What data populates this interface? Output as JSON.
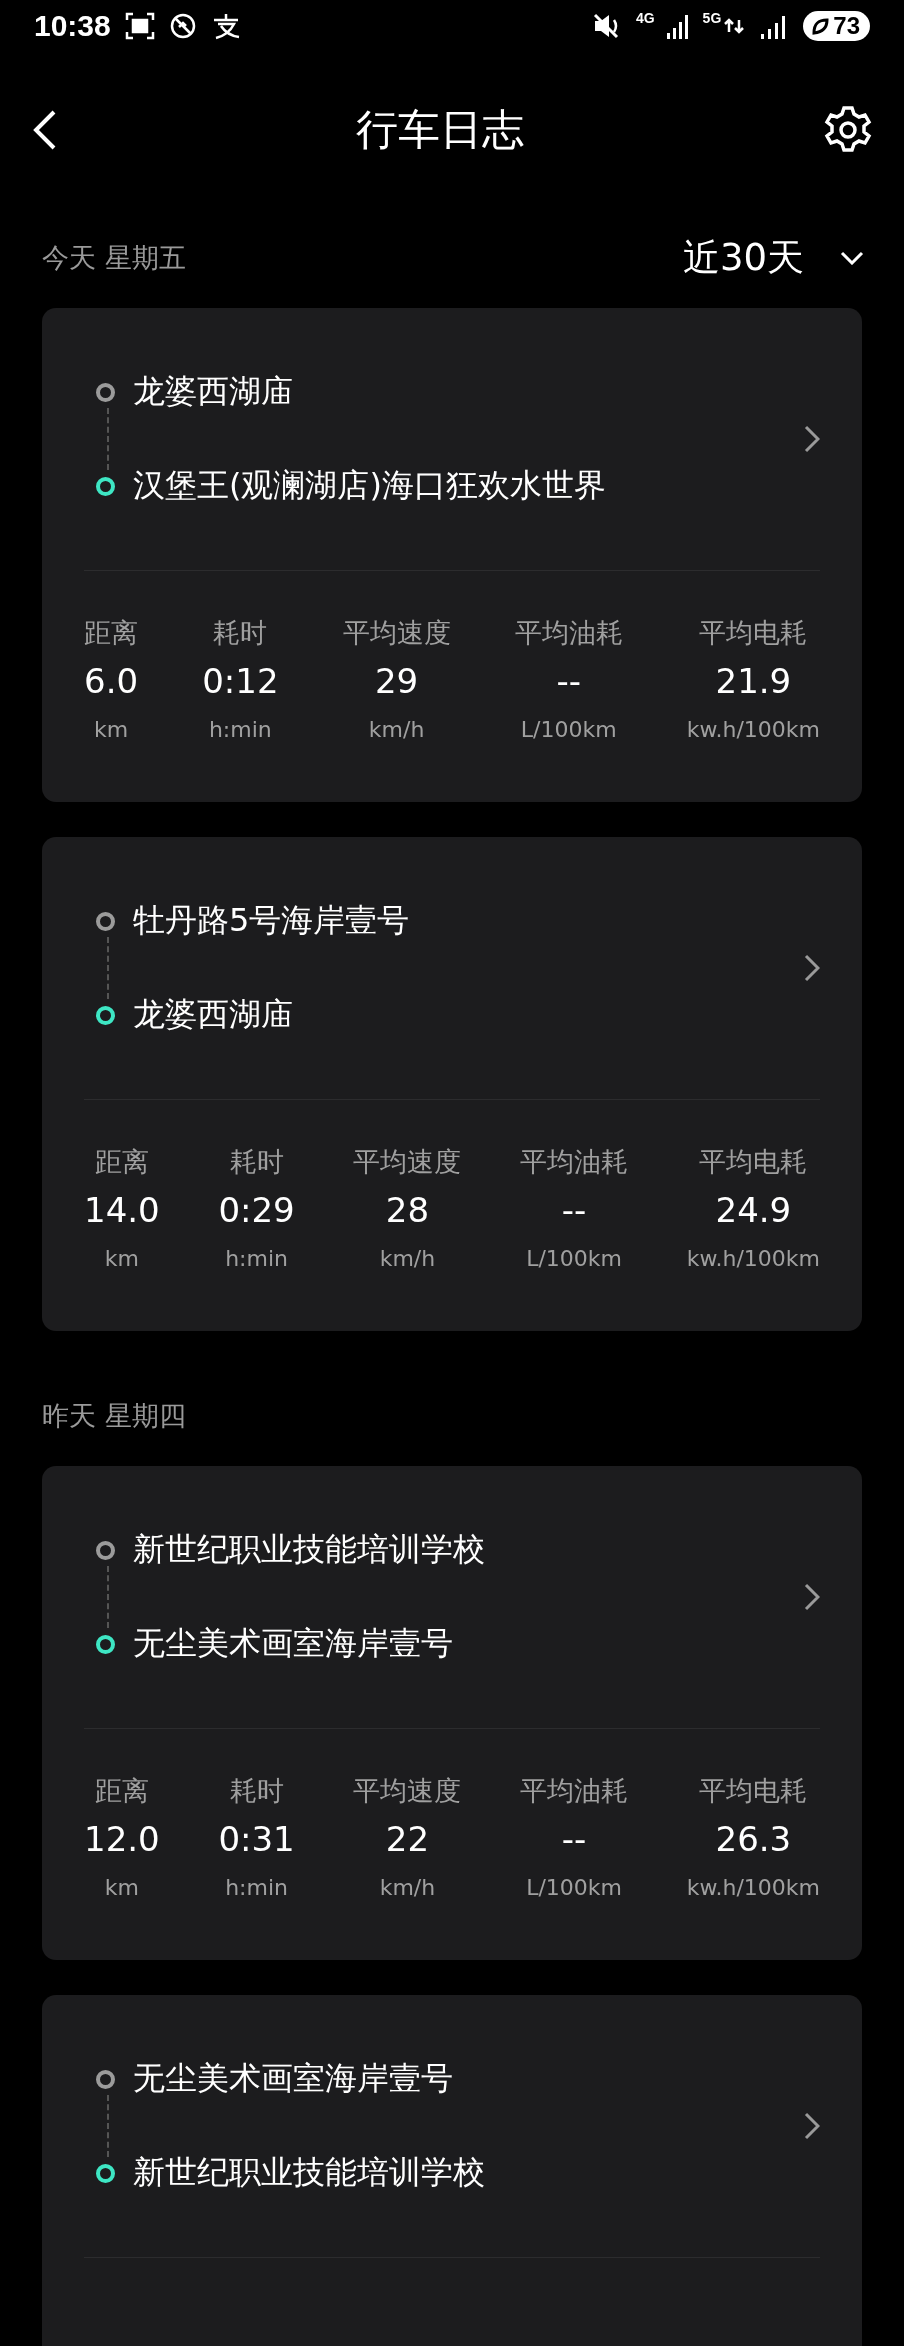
{
  "status_bar": {
    "time": "10:38",
    "network_1": "4G",
    "network_2": "5G",
    "battery": "73"
  },
  "header": {
    "title": "行车日志"
  },
  "filter": {
    "label": "近30天"
  },
  "sections": [
    {
      "label": "今天 星期五",
      "trips": [
        {
          "from": "龙婆西湖庙",
          "to": "汉堡王(观澜湖店)海口狂欢水世界",
          "stats": [
            {
              "label": "距离",
              "value": "6.0",
              "unit": "km"
            },
            {
              "label": "耗时",
              "value": "0:12",
              "unit": "h:min"
            },
            {
              "label": "平均速度",
              "value": "29",
              "unit": "km/h"
            },
            {
              "label": "平均油耗",
              "value": "--",
              "unit": "L/100km"
            },
            {
              "label": "平均电耗",
              "value": "21.9",
              "unit": "kw.h/100km"
            }
          ]
        },
        {
          "from": "牡丹路5号海岸壹号",
          "to": "龙婆西湖庙",
          "stats": [
            {
              "label": "距离",
              "value": "14.0",
              "unit": "km"
            },
            {
              "label": "耗时",
              "value": "0:29",
              "unit": "h:min"
            },
            {
              "label": "平均速度",
              "value": "28",
              "unit": "km/h"
            },
            {
              "label": "平均油耗",
              "value": "--",
              "unit": "L/100km"
            },
            {
              "label": "平均电耗",
              "value": "24.9",
              "unit": "kw.h/100km"
            }
          ]
        }
      ]
    },
    {
      "label": "昨天 星期四",
      "trips": [
        {
          "from": "新世纪职业技能培训学校",
          "to": "无尘美术画室海岸壹号",
          "stats": [
            {
              "label": "距离",
              "value": "12.0",
              "unit": "km"
            },
            {
              "label": "耗时",
              "value": "0:31",
              "unit": "h:min"
            },
            {
              "label": "平均速度",
              "value": "22",
              "unit": "km/h"
            },
            {
              "label": "平均油耗",
              "value": "--",
              "unit": "L/100km"
            },
            {
              "label": "平均电耗",
              "value": "26.3",
              "unit": "kw.h/100km"
            }
          ]
        },
        {
          "from": "无尘美术画室海岸壹号",
          "to": "新世纪职业技能培训学校"
        }
      ]
    }
  ]
}
